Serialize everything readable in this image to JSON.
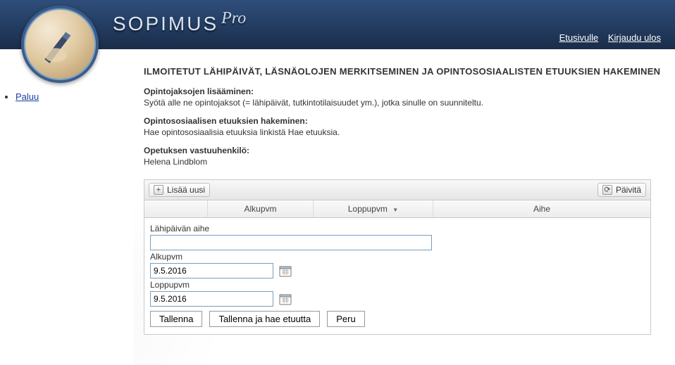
{
  "brand": {
    "name": "SOPIMUS",
    "suffix": "Pro"
  },
  "topnav": {
    "home": "Etusivulle",
    "logout": "Kirjaudu ulos"
  },
  "sidebar": {
    "items": [
      {
        "label": "Paluu"
      }
    ]
  },
  "page": {
    "title": "ILMOITETUT LÄHIPÄIVÄT, LÄSNÄOLOJEN MERKITSEMINEN JA OPINTOSOSIAALISTEN ETUUKSIEN HAKEMINEN",
    "sec1_label": "Opintojaksojen lisääminen:",
    "sec1_text": "Syötä alle ne opintojaksot (= lähipäivät, tutkintotilaisuudet ym.), jotka sinulle on suunniteltu.",
    "sec2_label": "Opintososiaalisen etuuksien hakeminen:",
    "sec2_text": "Hae opintososiaalisia etuuksia linkistä Hae etuuksia.",
    "sec3_label": "Opetuksen vastuuhenkilö:",
    "sec3_text": "Helena Lindblom"
  },
  "grid": {
    "add_label": "Lisää uusi",
    "refresh_label": "Päivitä",
    "columns": {
      "start": "Alkupvm",
      "end": "Loppupvm",
      "topic": "Aihe"
    },
    "form": {
      "topic_label": "Lähipäivän aihe",
      "topic_value": "",
      "start_label": "Alkupvm",
      "start_value": "9.5.2016",
      "end_label": "Loppupvm",
      "end_value": "9.5.2016",
      "save": "Tallenna",
      "save_apply": "Tallenna ja hae etuutta",
      "cancel": "Peru"
    }
  }
}
